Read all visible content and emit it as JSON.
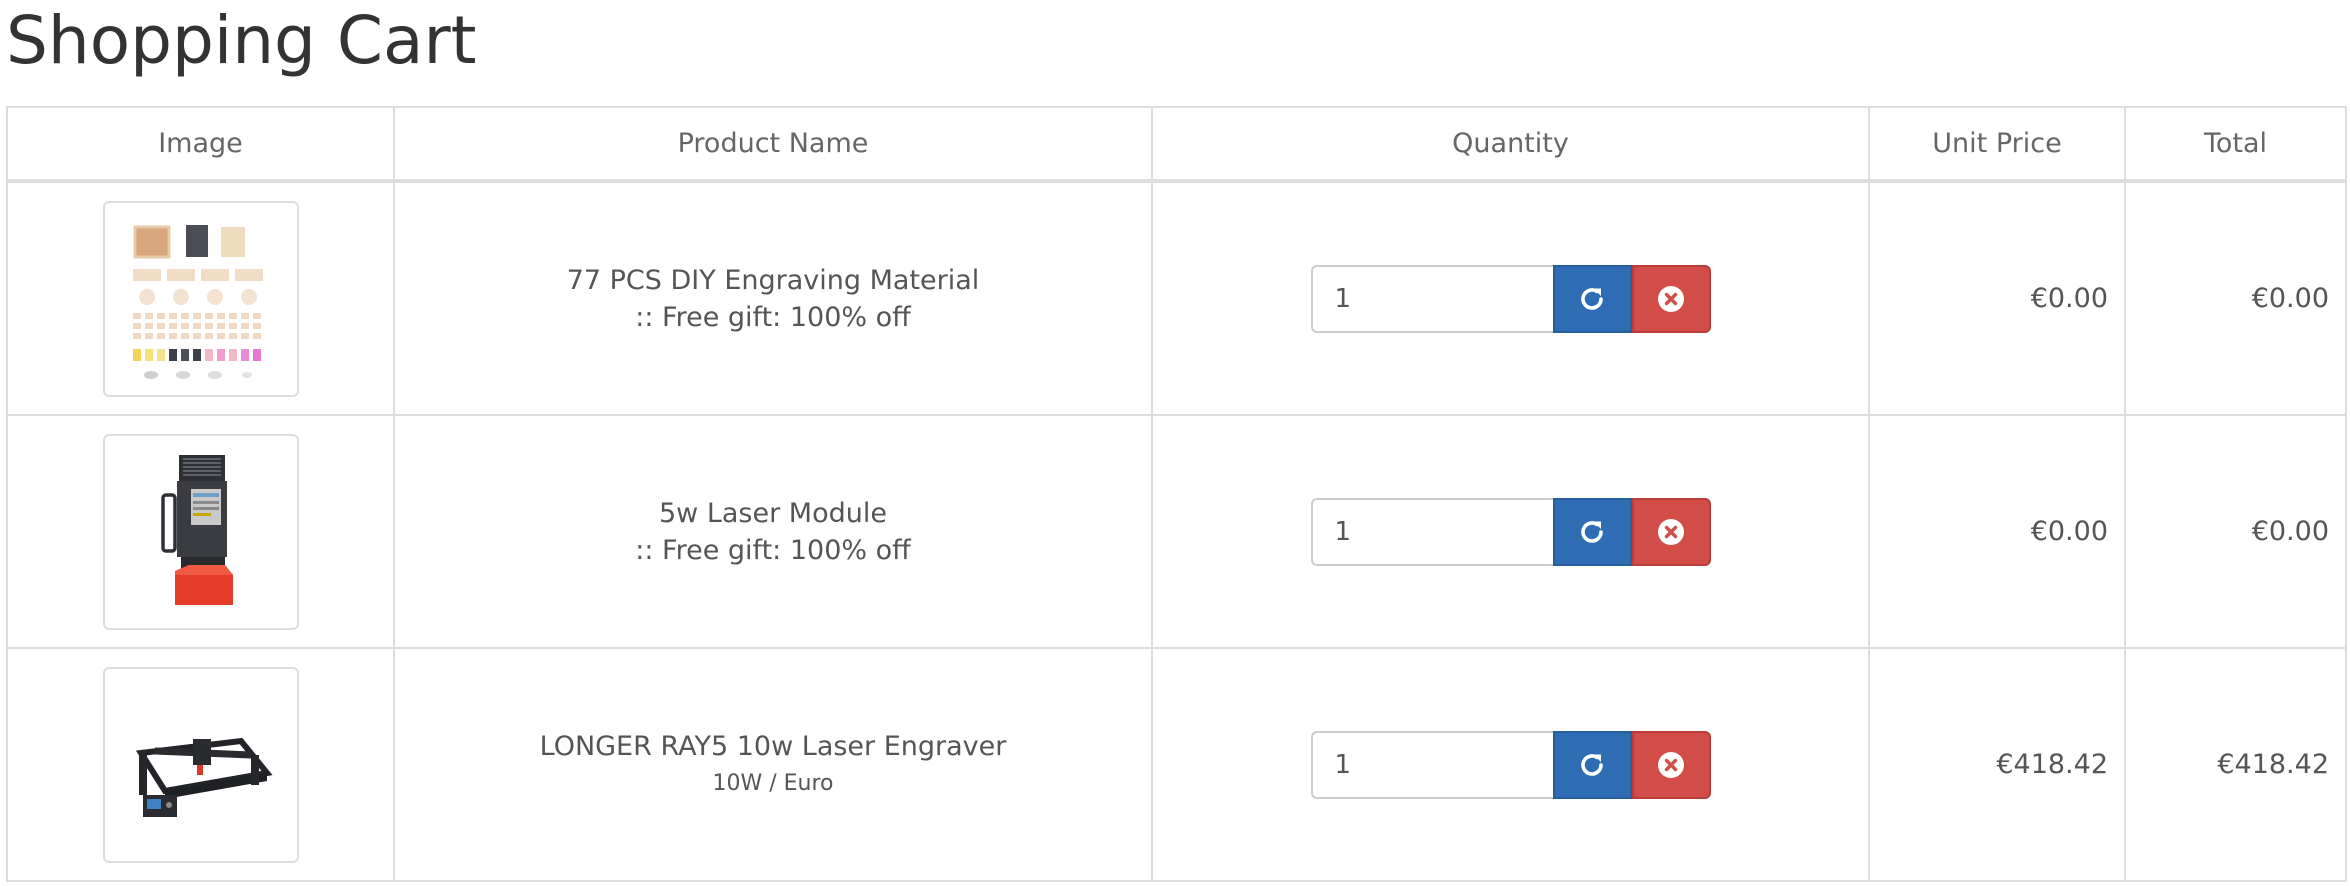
{
  "page": {
    "title": "Shopping Cart"
  },
  "table": {
    "headers": {
      "image": "Image",
      "product_name": "Product Name",
      "quantity": "Quantity",
      "unit_price": "Unit Price",
      "total": "Total"
    },
    "rows": [
      {
        "product_name": "77 PCS DIY Engraving Material",
        "option": ":: Free gift: 100% off",
        "quantity": "1",
        "unit_price": "€0.00",
        "total": "€0.00",
        "image_icon": "engraving-material-kit-icon"
      },
      {
        "product_name": "5w Laser Module",
        "option": ":: Free gift: 100% off",
        "quantity": "1",
        "unit_price": "€0.00",
        "total": "€0.00",
        "image_icon": "laser-module-icon"
      },
      {
        "product_name": "LONGER RAY5 10w Laser Engraver",
        "option": "10W / Euro",
        "quantity": "1",
        "unit_price": "€418.42",
        "total": "€418.42",
        "image_icon": "laser-engraver-icon"
      }
    ]
  },
  "colors": {
    "update_button": "#2e6db4",
    "remove_button": "#d24d47",
    "border": "#dddddd"
  },
  "icons": {
    "update": "refresh-icon",
    "remove": "remove-circle-icon"
  }
}
